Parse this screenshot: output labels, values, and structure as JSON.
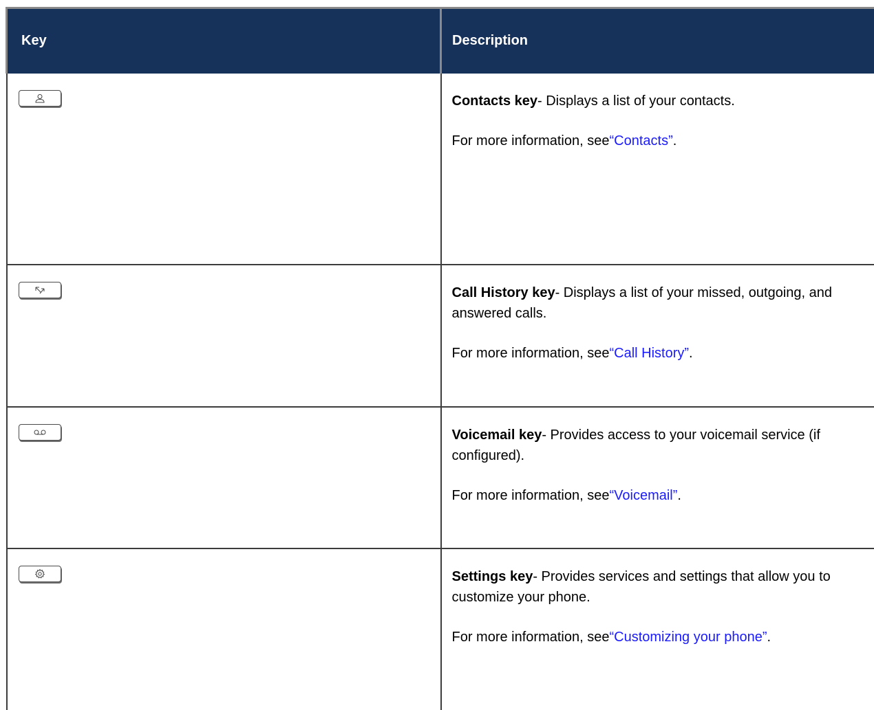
{
  "table": {
    "headers": {
      "key": "Key",
      "description": "Description"
    },
    "rows": [
      {
        "icon": "contacts-icon",
        "term": "Contacts key",
        "text": "- Displays a list of your contacts.",
        "more_prefix": "For more information, see",
        "link": "“Contacts”",
        "suffix": "."
      },
      {
        "icon": "call-history-icon",
        "term": "Call History key",
        "text": "- Displays a list of your missed, outgoing, and answered calls.",
        "more_prefix": "For more information, see",
        "link": "“Call History”",
        "suffix": "."
      },
      {
        "icon": "voicemail-icon",
        "term": "Voicemail key",
        "text": "- Provides access to your voicemail service (if configured).",
        "more_prefix": "For more information, see",
        "link": "“Voicemail”",
        "suffix": "."
      },
      {
        "icon": "settings-gear-icon",
        "term": "Settings key",
        "text": "- Provides services and settings that allow you to customize your phone.",
        "more_prefix": "For more information, see",
        "link": "“Customizing your phone”",
        "suffix": "."
      }
    ]
  },
  "colors": {
    "header_bg": "#16325b",
    "header_text": "#ffffff",
    "link": "#1a1aff"
  }
}
